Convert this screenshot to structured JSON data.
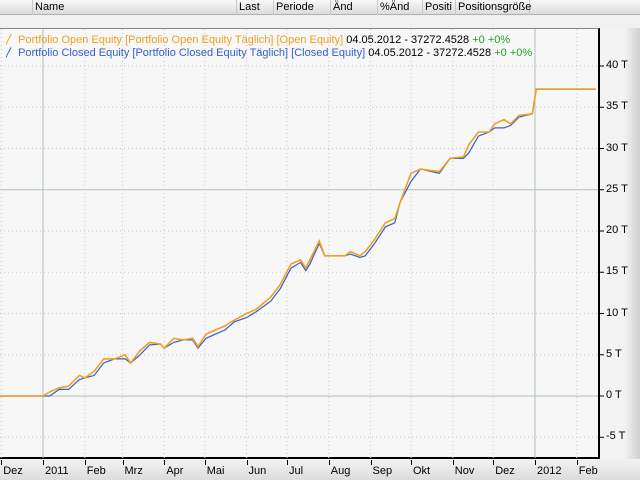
{
  "header": {
    "columns": [
      "Name",
      "Last",
      "Periode",
      "Änd",
      "%Änd",
      "Positi",
      "Positionsgröße"
    ]
  },
  "legend": [
    {
      "icon": "line-chart-icon",
      "label": "Portfolio Open Equity [Portfolio Open Equity  Täglich] [Open Equity]",
      "value": "04.05.2012 - 37272.4528",
      "change": "+0 +0%",
      "color": "#f0a020"
    },
    {
      "icon": "line-chart-icon",
      "label": "Portfolio Closed Equity [Portfolio Closed Equity  Täglich] [Closed Equity]",
      "value": "04.05.2012 - 37272.4528",
      "change": "+0 +0%",
      "color": "#3060d0"
    }
  ],
  "colors": {
    "value_text": "#000000",
    "change": "#20a020"
  },
  "chart_data": {
    "type": "line",
    "ylim": [
      -8,
      44
    ],
    "xlim": [
      "2010-11-29",
      "2012-02-15"
    ],
    "y_ticks": [
      "-5 T",
      "0 T",
      "5 T",
      "10 T",
      "15 T",
      "20 T",
      "25 T",
      "30 T",
      "35 T",
      "40 T"
    ],
    "y_tick_values": [
      -5,
      0,
      5,
      10,
      15,
      20,
      25,
      30,
      35,
      40
    ],
    "x_ticks": [
      "Dez",
      "2011",
      "Feb",
      "Mrz",
      "Apr",
      "Mai",
      "Jun",
      "Jul",
      "Aug",
      "Sep",
      "Okt",
      "Nov",
      "Dez",
      "2012",
      "Feb"
    ],
    "x_tick_dates": [
      "2010-12-01",
      "2011-01-01",
      "2011-02-01",
      "2011-03-01",
      "2011-04-01",
      "2011-05-01",
      "2011-06-01",
      "2011-07-01",
      "2011-08-01",
      "2011-09-01",
      "2011-10-01",
      "2011-11-01",
      "2011-12-01",
      "2012-01-01",
      "2012-02-01"
    ],
    "grid": true,
    "x": [
      "2010-11-29",
      "2011-01-01",
      "2011-01-06",
      "2011-01-13",
      "2011-01-20",
      "2011-01-28",
      "2011-02-01",
      "2011-02-08",
      "2011-02-15",
      "2011-02-23",
      "2011-03-03",
      "2011-03-07",
      "2011-03-14",
      "2011-03-21",
      "2011-03-29",
      "2011-04-01",
      "2011-04-08",
      "2011-04-15",
      "2011-04-22",
      "2011-04-26",
      "2011-05-02",
      "2011-05-09",
      "2011-05-16",
      "2011-05-23",
      "2011-06-01",
      "2011-06-08",
      "2011-06-19",
      "2011-06-26",
      "2011-07-04",
      "2011-07-11",
      "2011-07-15",
      "2011-07-18",
      "2011-07-25",
      "2011-07-29",
      "2011-08-13",
      "2011-08-17",
      "2011-08-24",
      "2011-08-28",
      "2011-09-04",
      "2011-09-12",
      "2011-09-19",
      "2011-09-23",
      "2011-10-01",
      "2011-10-08",
      "2011-10-22",
      "2011-10-30",
      "2011-11-09",
      "2011-11-13",
      "2011-11-20",
      "2011-11-28",
      "2011-12-02",
      "2011-12-09",
      "2011-12-14",
      "2011-12-20",
      "2011-12-30",
      "2012-01-02",
      "2012-02-15"
    ],
    "series": [
      {
        "name": "Portfolio Open Equity",
        "color": "#f0a020",
        "values": [
          0,
          0,
          0.5,
          1,
          1.2,
          2.5,
          2.2,
          3,
          4.5,
          4.5,
          5,
          4,
          5.5,
          6.5,
          6.3,
          5.8,
          7,
          6.8,
          7,
          6,
          7.5,
          8,
          8.5,
          9.2,
          10,
          10.5,
          12,
          13.5,
          16,
          16.5,
          15.5,
          16.5,
          18.8,
          17,
          17,
          17.5,
          17,
          17.5,
          19,
          21,
          21.5,
          23.5,
          27,
          27.5,
          27.2,
          28.8,
          29,
          30.5,
          32,
          32,
          33,
          33.5,
          33,
          34,
          34.2,
          37.2,
          37.2
        ]
      },
      {
        "name": "Portfolio Closed Equity",
        "color": "#3060d0",
        "values": [
          0,
          0,
          0,
          0.8,
          0.8,
          2,
          2.2,
          2.5,
          4,
          4.5,
          4.5,
          4,
          5,
          6.2,
          6.3,
          5.8,
          6.5,
          6.8,
          6.8,
          5.8,
          7,
          7.5,
          8,
          9,
          9.5,
          10.2,
          11.5,
          13,
          15.5,
          16.2,
          15.2,
          16,
          18.5,
          17,
          17,
          17.2,
          16.8,
          17,
          18.5,
          20.5,
          21,
          23.5,
          26,
          27.5,
          27,
          28.8,
          28.8,
          29.5,
          31.5,
          32,
          32.5,
          32.5,
          32.8,
          33.8,
          34.2,
          37.2,
          37.2
        ]
      }
    ]
  }
}
